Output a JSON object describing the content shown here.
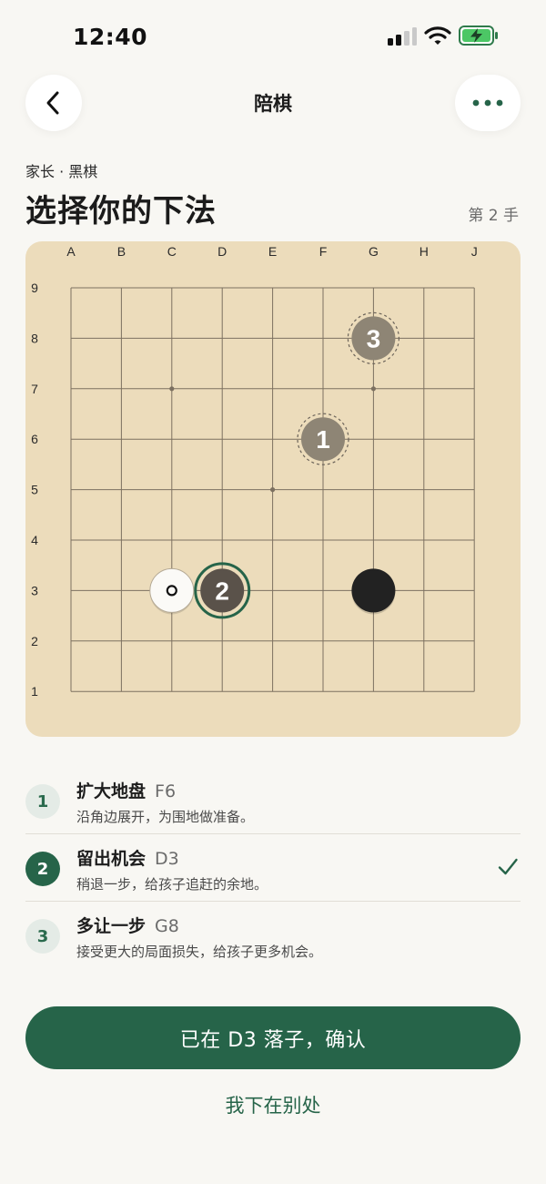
{
  "status_bar": {
    "time": "12:40"
  },
  "nav": {
    "title": "陪棋",
    "back_icon": "chevron-left-icon",
    "more_icon": "ellipsis-icon"
  },
  "header": {
    "subtitle": "家长 · 黑棋",
    "title": "选择你的下法",
    "move_number": "第 2 手"
  },
  "board": {
    "columns": [
      "A",
      "B",
      "C",
      "D",
      "E",
      "F",
      "G",
      "H",
      "J"
    ],
    "rows": [
      "9",
      "8",
      "7",
      "6",
      "5",
      "4",
      "3",
      "2",
      "1"
    ],
    "star_points": [
      "C7",
      "G7",
      "E5"
    ],
    "stones": [
      {
        "coord": "C3",
        "color": "white",
        "marker": "last-move-circle"
      },
      {
        "coord": "G3",
        "color": "black",
        "marker": ""
      }
    ],
    "candidates": [
      {
        "coord": "F6",
        "label": "1",
        "state": "candidate"
      },
      {
        "coord": "D3",
        "label": "2",
        "state": "selected"
      },
      {
        "coord": "G8",
        "label": "3",
        "state": "candidate"
      }
    ],
    "colors": {
      "board": "#ecdcbb",
      "line": "#7c7060",
      "candidate": "#8e8575",
      "selected": "#5a524a",
      "accent": "#266449"
    }
  },
  "options": [
    {
      "num": "1",
      "title": "扩大地盘",
      "coord": "F6",
      "desc": "沿角边展开，为围地做准备。",
      "selected": false
    },
    {
      "num": "2",
      "title": "留出机会",
      "coord": "D3",
      "desc": "稍退一步，给孩子追赶的余地。",
      "selected": true
    },
    {
      "num": "3",
      "title": "多让一步",
      "coord": "G8",
      "desc": "接受更大的局面损失，给孩子更多机会。",
      "selected": false
    }
  ],
  "actions": {
    "confirm_label": "已在 D3 落子，确认",
    "alt_label": "我下在别处"
  }
}
